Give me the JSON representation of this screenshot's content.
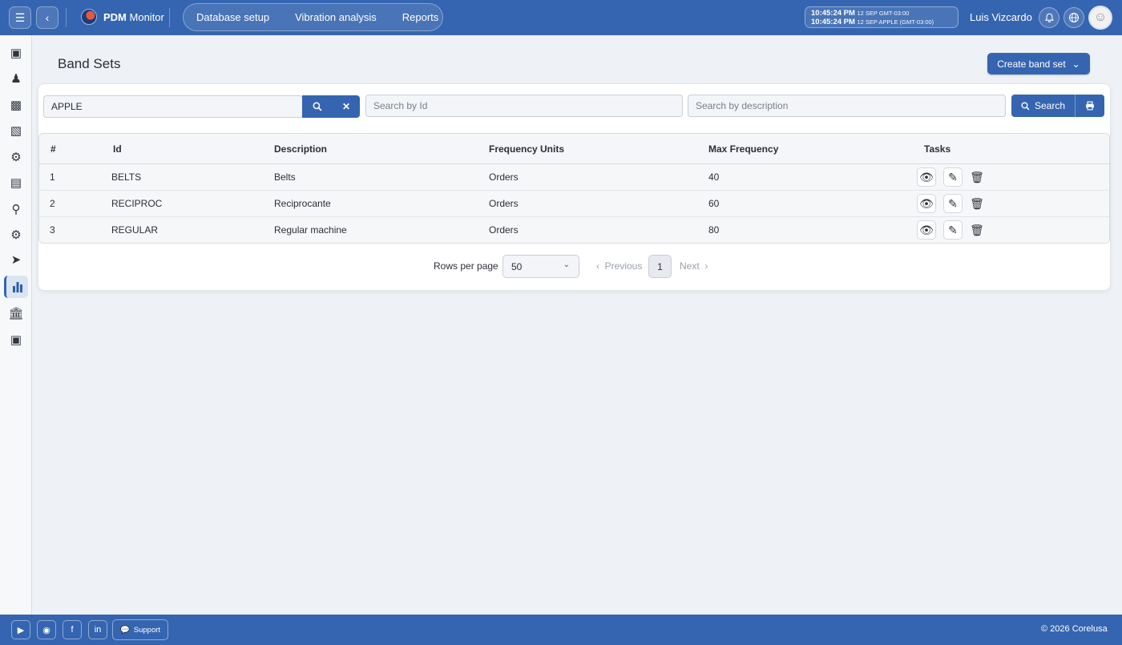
{
  "header": {
    "app_name_bold": "PDM",
    "app_name_rest": "Monitor",
    "nav": [
      "Database setup",
      "Vibration analysis",
      "Reports"
    ],
    "clock_line1_time": "10:45:24 PM",
    "clock_line1_meta": "12 SEP  GMT-03:00",
    "clock_line2_time": "10:45:24 PM",
    "clock_line2_meta": "12 SEP  APPLE (GMT-03:00)",
    "user_name": "Luis Vizcardo"
  },
  "page": {
    "title": "Band Sets",
    "create_label": "Create band set"
  },
  "filters": {
    "customer_value": "APPLE",
    "id_placeholder": "Search by Id",
    "description_placeholder": "Search by description",
    "search_label": "Search"
  },
  "table": {
    "headers": [
      "#",
      "Id",
      "Description",
      "Frequency Units",
      "Max Frequency",
      "Tasks"
    ],
    "rows": [
      {
        "num": "1",
        "id": "BELTS",
        "description": "Belts",
        "units": "Orders",
        "max_freq": "40"
      },
      {
        "num": "2",
        "id": "RECIPROC",
        "description": "Reciprocante",
        "units": "Orders",
        "max_freq": "60"
      },
      {
        "num": "3",
        "id": "REGULAR",
        "description": "Regular machine",
        "units": "Orders",
        "max_freq": "80"
      }
    ]
  },
  "pagination": {
    "rows_label": "Rows per page",
    "rows_value": "50",
    "previous": "Previous",
    "page": "1",
    "next": "Next"
  },
  "footer": {
    "support_label": "Support",
    "copyright": "© 2026 Corelusa"
  },
  "colors": {
    "primary": "#3565b0",
    "background": "#eef1f5"
  }
}
